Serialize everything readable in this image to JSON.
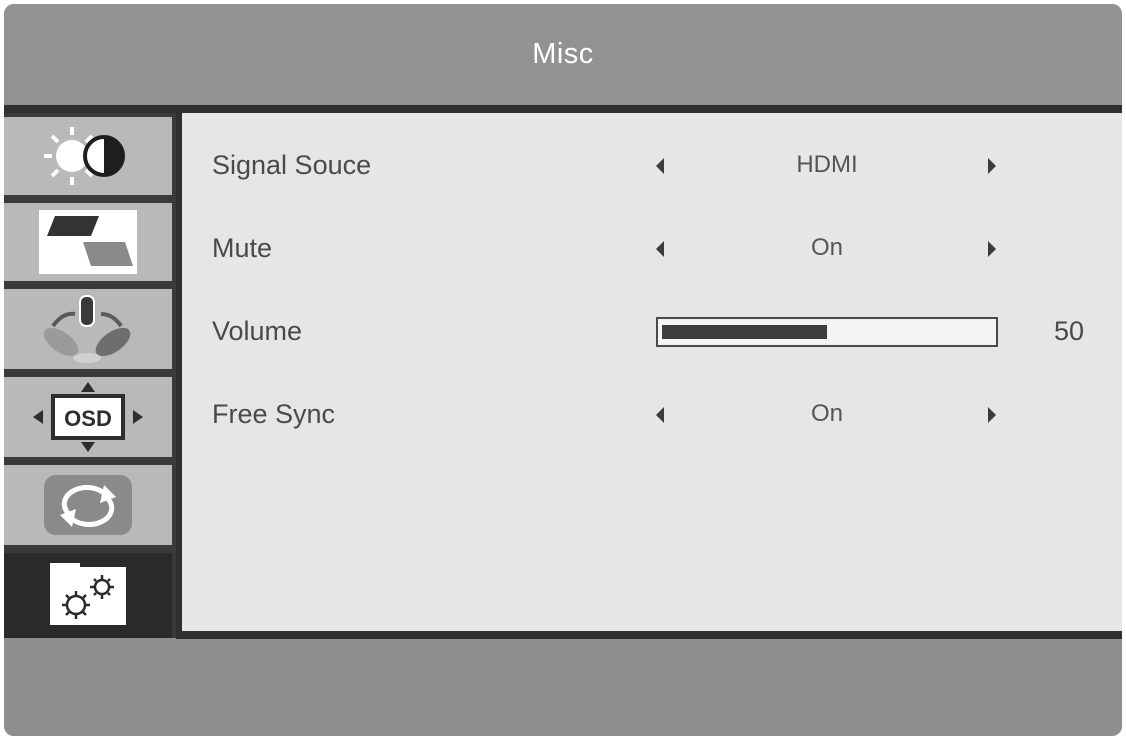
{
  "header": {
    "title": "Misc"
  },
  "sidebar": {
    "items": [
      {
        "name": "brightness-contrast",
        "icon": "brightness-contrast-icon",
        "selected": false
      },
      {
        "name": "image",
        "icon": "picture-icon",
        "selected": false
      },
      {
        "name": "color",
        "icon": "color-rgb-icon",
        "selected": false
      },
      {
        "name": "osd",
        "icon": "osd-icon",
        "label": "OSD",
        "selected": false
      },
      {
        "name": "reset",
        "icon": "reset-icon",
        "selected": false
      },
      {
        "name": "misc",
        "icon": "gears-icon",
        "selected": true
      }
    ]
  },
  "settings": {
    "signal_source": {
      "label": "Signal Souce",
      "value": "HDMI"
    },
    "mute": {
      "label": "Mute",
      "value": "On"
    },
    "volume": {
      "label": "Volume",
      "value": "50",
      "level": 0.5
    },
    "free_sync": {
      "label": "Free Sync",
      "value": "On"
    }
  },
  "colors": {
    "frame": "#8e8e8e",
    "panel": "#e6e6e6",
    "rule": "#2f2f2f",
    "sidebar_item": "#b9b9b9",
    "sidebar_selected": "#2a2a2a",
    "text": "#4a4a4a"
  }
}
